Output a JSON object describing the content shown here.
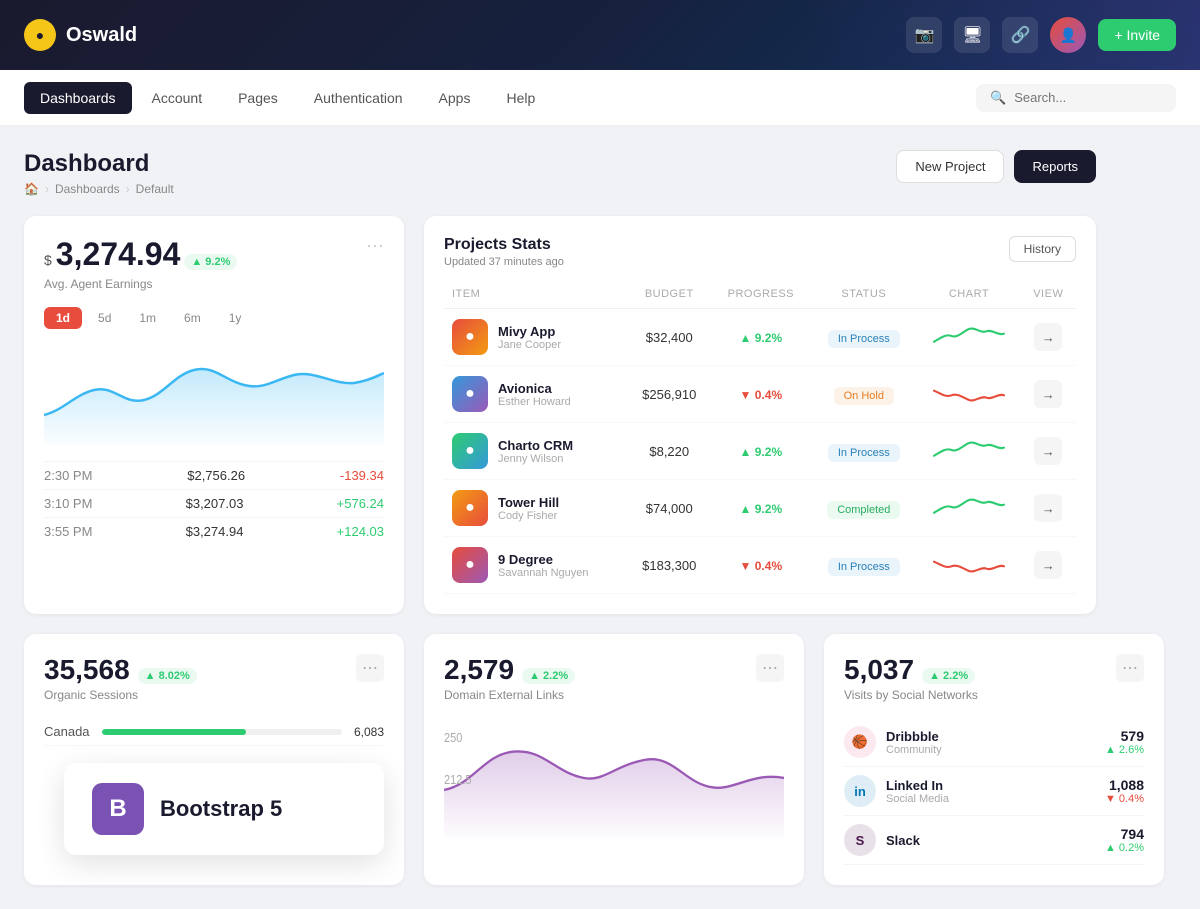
{
  "topNav": {
    "logoText": "Oswald",
    "inviteLabel": "+ Invite",
    "icons": [
      "📷",
      "🖥",
      "🔗"
    ]
  },
  "secNav": {
    "items": [
      "Dashboards",
      "Account",
      "Pages",
      "Authentication",
      "Apps",
      "Help"
    ],
    "activeItem": "Dashboards",
    "searchPlaceholder": "Search..."
  },
  "pageHeader": {
    "title": "Dashboard",
    "breadcrumbs": [
      "🏠",
      "Dashboards",
      "Default"
    ],
    "newProjectLabel": "New Project",
    "reportsLabel": "Reports"
  },
  "earningsCard": {
    "currency": "$",
    "value": "3,274.94",
    "badge": "▲ 9.2%",
    "label": "Avg. Agent Earnings",
    "timeFilters": [
      "1d",
      "5d",
      "1m",
      "6m",
      "1y"
    ],
    "activeFilter": "1d",
    "rows": [
      {
        "time": "2:30 PM",
        "amount": "$2,756.26",
        "change": "-139.34",
        "type": "neg"
      },
      {
        "time": "3:10 PM",
        "amount": "$3,207.03",
        "change": "+576.24",
        "type": "pos"
      },
      {
        "time": "3:55 PM",
        "amount": "$3,274.94",
        "change": "+124.03",
        "type": "pos"
      }
    ]
  },
  "projectsCard": {
    "title": "Projects Stats",
    "subtitle": "Updated 37 minutes ago",
    "historyLabel": "History",
    "columns": [
      "ITEM",
      "BUDGET",
      "PROGRESS",
      "STATUS",
      "CHART",
      "VIEW"
    ],
    "rows": [
      {
        "name": "Mivy App",
        "person": "Jane Cooper",
        "budget": "$32,400",
        "progress": "▲ 9.2%",
        "progressType": "up",
        "status": "In Process",
        "statusType": "inprocess",
        "color": "#e74c3c"
      },
      {
        "name": "Avionica",
        "person": "Esther Howard",
        "budget": "$256,910",
        "progress": "▼ 0.4%",
        "progressType": "down",
        "status": "On Hold",
        "statusType": "onhold",
        "color": "#e67e22"
      },
      {
        "name": "Charto CRM",
        "person": "Jenny Wilson",
        "budget": "$8,220",
        "progress": "▲ 9.2%",
        "progressType": "up",
        "status": "In Process",
        "statusType": "inprocess",
        "color": "#3498db"
      },
      {
        "name": "Tower Hill",
        "person": "Cody Fisher",
        "budget": "$74,000",
        "progress": "▲ 9.2%",
        "progressType": "up",
        "status": "Completed",
        "statusType": "completed",
        "color": "#27ae60"
      },
      {
        "name": "9 Degree",
        "person": "Savannah Nguyen",
        "budget": "$183,300",
        "progress": "▼ 0.4%",
        "progressType": "down",
        "status": "In Process",
        "statusType": "inprocess",
        "color": "#9b59b6"
      }
    ]
  },
  "organicCard": {
    "value": "35,568",
    "badge": "▲ 8.02%",
    "label": "Organic Sessions",
    "mapRows": [
      {
        "country": "Canada",
        "value": "6,083",
        "pct": 60
      }
    ]
  },
  "domainCard": {
    "value": "2,579",
    "badge": "▲ 2.2%",
    "label": "Domain External Links"
  },
  "socialCard": {
    "value": "5,037",
    "badge": "▲ 2.2%",
    "label": "Visits by Social Networks",
    "items": [
      {
        "name": "Dribbble",
        "type": "Community",
        "count": "579",
        "change": "▲ 2.6%",
        "changeType": "up",
        "color": "#ea4c89",
        "icon": "🏀"
      },
      {
        "name": "Linked In",
        "type": "Social Media",
        "count": "1,088",
        "change": "▼ 0.4%",
        "changeType": "down",
        "color": "#0077b5",
        "icon": "in"
      },
      {
        "name": "Slack",
        "type": "",
        "count": "794",
        "change": "▲ 0.2%",
        "changeType": "up",
        "color": "#4a154b",
        "icon": "S"
      }
    ]
  },
  "bootstrapOverlay": {
    "iconLabel": "B",
    "text": "Bootstrap 5"
  }
}
